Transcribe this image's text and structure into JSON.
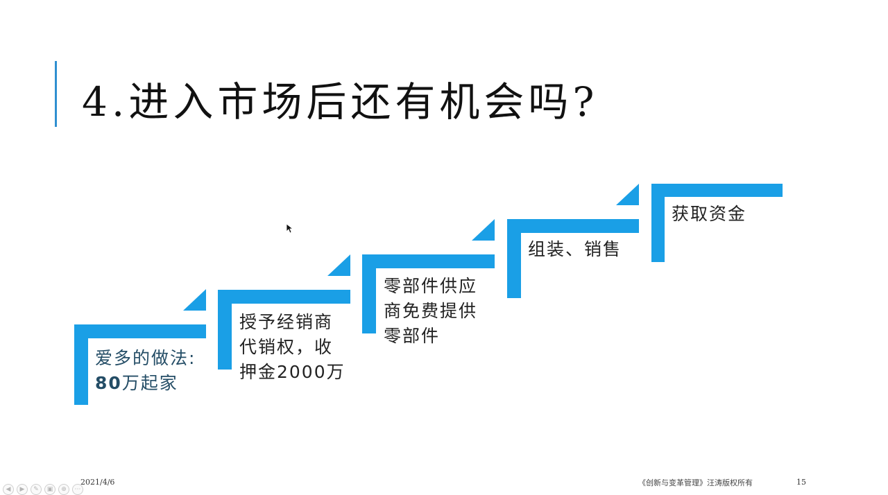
{
  "slide": {
    "title": "4.进入市场后还有机会吗?",
    "accent_color": "#1a9fe6",
    "steps": [
      {
        "line1": "爱多的做法:",
        "line2_bold": "80",
        "line2_rest": "万起家"
      },
      {
        "line1": "授予经销商",
        "line2": "代销权，收",
        "line3": "押金2000万"
      },
      {
        "line1": "零部件供应",
        "line2": "商免费提供",
        "line3": "零部件"
      },
      {
        "line1": "组装、销售"
      },
      {
        "line1": "获取资金"
      }
    ]
  },
  "footer": {
    "date": "2021/4/6",
    "copyright": "《创新与变革管理》汪涛版权所有",
    "page_number": "15"
  },
  "controls": {
    "icons": [
      "prev-icon",
      "next-icon",
      "pen-icon",
      "slides-icon",
      "zoom-icon",
      "more-icon"
    ],
    "glyphs": [
      "◀",
      "▶",
      "✎",
      "▣",
      "⊕",
      "⋯"
    ]
  }
}
